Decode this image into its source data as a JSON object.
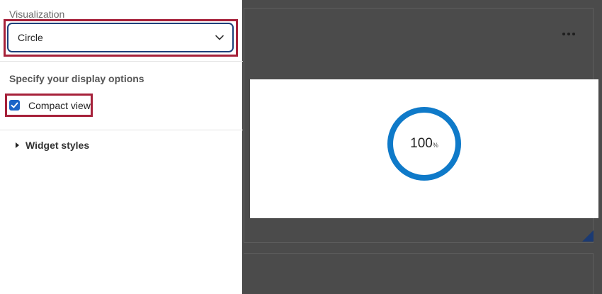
{
  "panel": {
    "visualization_label": "Visualization",
    "visualization_value": "Circle",
    "display_options_title": "Specify your display options",
    "compact_view_label": "Compact view",
    "compact_view_checked": true,
    "widget_styles_label": "Widget styles"
  },
  "preview": {
    "value": "100",
    "unit": "%",
    "progress_fraction": 1.0,
    "ring_color": "#0f7ac9"
  },
  "colors": {
    "highlight": "#a6213a",
    "select_border": "#1d3f7a",
    "checkbox": "#1a64c8",
    "overlay": "#4b4b4b",
    "resize_handle": "#1b3a73"
  },
  "icons": {
    "dropdown": "chevron-down-icon",
    "checkbox": "checkmark-icon",
    "expand": "caret-right-icon",
    "more": "more-horizontal-icon",
    "resize": "resize-corner-icon"
  }
}
